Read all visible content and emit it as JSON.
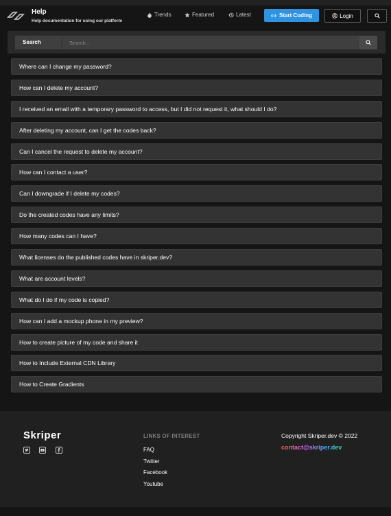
{
  "header": {
    "title": "Help",
    "subtitle": "Help documentation for using our platform",
    "nav": [
      "Trends",
      "Featured",
      "Latest"
    ],
    "start_label": "Start Coding",
    "login_label": "Login"
  },
  "search": {
    "label": "Search",
    "placeholder": "Search..."
  },
  "faq": [
    "Where can I change my password?",
    "How can I delete my account?",
    "I received an email with a temporary password to access, but I did not request it, what should I do?",
    "After deleting my account, can I get the codes back?",
    "Can I cancel the request to delete my account?",
    "How can I contact a user?",
    "Can I downgrade if I delete my codes?",
    "Do the created codes have any limits?",
    "How many codes can I have?",
    "What licenses do the published codes have in skriper.dev?",
    "What are account levels?",
    "What do I do if my code is copied?",
    "How can I add a mockup phone in my preview?",
    "How to create picture of my code and share it",
    "How to Include External CDN Library",
    "How to Create Gradients"
  ],
  "footer": {
    "brand": "Skriper",
    "heading": "LINKS OF INTEREST",
    "links": [
      "FAQ",
      "Twitter",
      "Facebook",
      "Youtube"
    ],
    "copyright": "Copyright Skriper.dev © 2022",
    "email": "contact@skriper.dev",
    "social_icons": [
      "twitter-icon",
      "youtube-icon",
      "facebook-icon"
    ]
  },
  "colors": {
    "background": "#151515",
    "accent": "#2f93e0",
    "faq_item_bg": "#333333",
    "footer_bg": "#202020"
  }
}
